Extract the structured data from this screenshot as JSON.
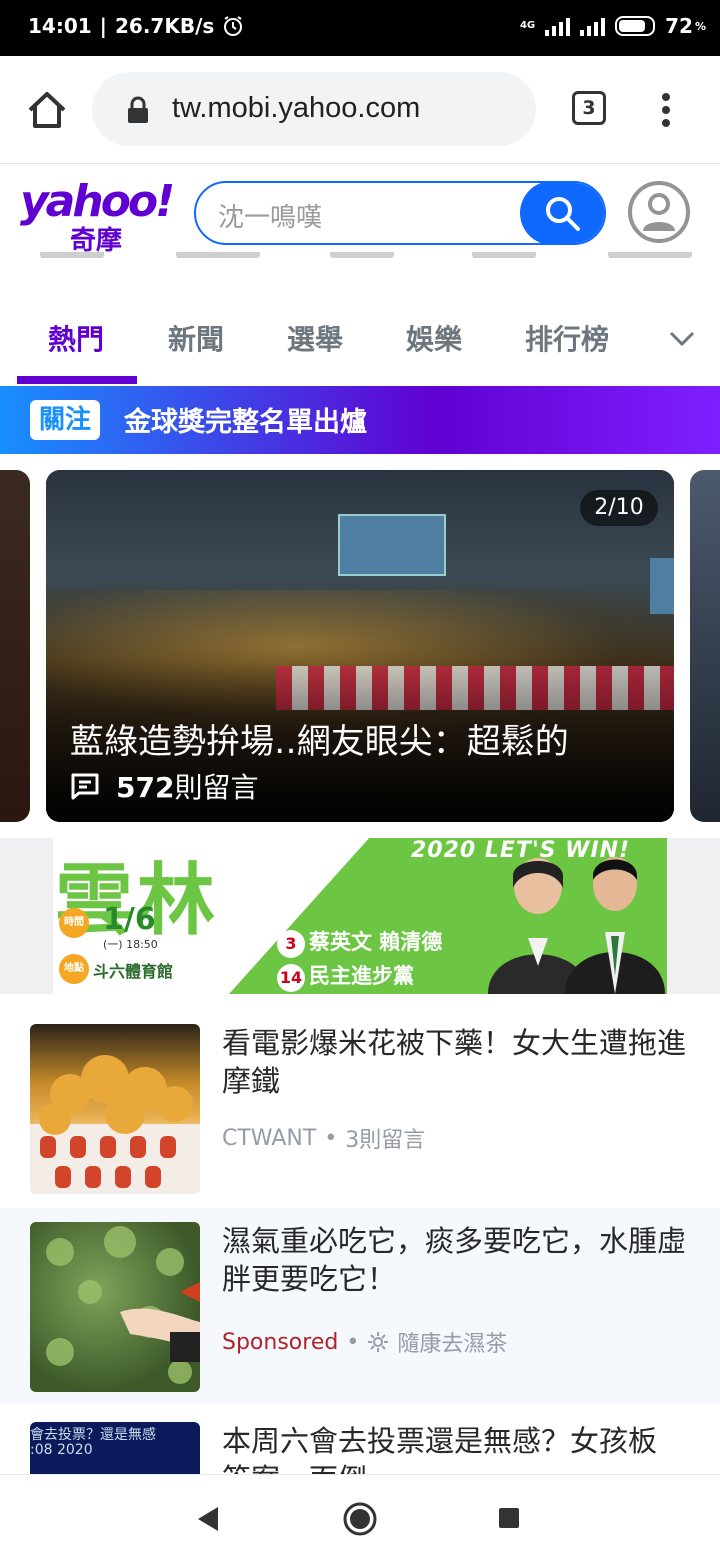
{
  "status_bar": {
    "time": "14:01",
    "network_speed": "26.7KB/s",
    "network_type": "4G",
    "battery": "72",
    "battery_unit": "%"
  },
  "browser": {
    "url": "tw.mobi.yahoo.com",
    "tab_count": "3"
  },
  "header": {
    "logo_text": "yahoo!",
    "logo_sub": "奇摩",
    "search_placeholder": "沈一鳴嘆"
  },
  "categories": [
    "熱門",
    "新聞",
    "選舉",
    "娛樂",
    "排行榜"
  ],
  "active_category": "熱門",
  "focus": {
    "badge": "關注",
    "text": "金球獎完整名單出爐"
  },
  "carousel": {
    "counter": "2/10",
    "title": "藍綠造勢拚場‥網友眼尖：超鬆的",
    "comment_count": "572",
    "comment_suffix": "則留言"
  },
  "ad": {
    "title": "雲林",
    "slogan": "2020 LET'S WIN!",
    "time_label": "時間",
    "date": "1/6",
    "time": "(一) 18:50",
    "venue_label": "地點",
    "venue": "斗六體育館",
    "num1": "3",
    "line1": "蔡英文 賴清德",
    "num2": "14",
    "line2": "民主進步黨"
  },
  "news": [
    {
      "title": "看電影爆米花被下藥！女大生遭拖進摩鐵",
      "source": "CTWANT",
      "sep": "•",
      "comments": "3則留言"
    },
    {
      "title": "濕氣重必吃它，痰多要吃它，水腫虛胖更要吃它！",
      "sponsored": "Sponsored",
      "sep": "•",
      "source": "隨康去濕茶"
    },
    {
      "title": "本周六會去投票還是無感？女孩板",
      "title_cut": "答案一面倒",
      "thumb_text": "會去投票？還是無感",
      "thumb_date": ":08 2020"
    }
  ],
  "colors": {
    "brand": "#6001d2",
    "search_blue": "#0f69ff",
    "sponsored": "#b0232a"
  }
}
